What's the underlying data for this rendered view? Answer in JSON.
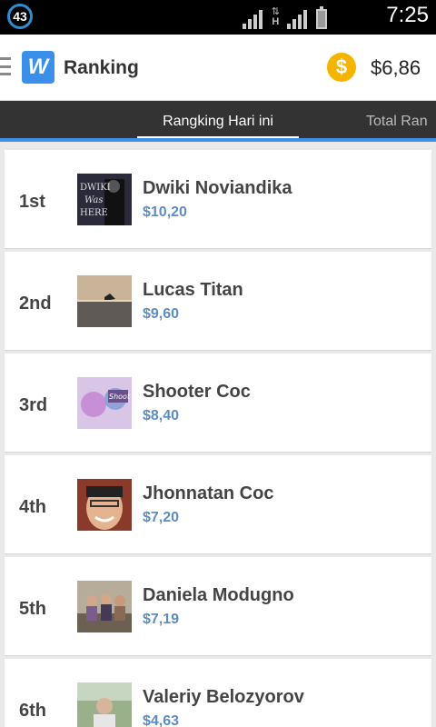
{
  "status_bar": {
    "notification_count": "43",
    "network_type": "H",
    "time": "7:25"
  },
  "app_bar": {
    "logo_letter": "W",
    "title": "Ranking",
    "coin_symbol": "$",
    "balance": "$6,86"
  },
  "tabs": [
    {
      "label": "Rangking Hari ini",
      "active": true
    },
    {
      "label": "Total Ran",
      "active": false
    }
  ],
  "ranking": [
    {
      "rank": "1st",
      "name": "Dwiki Noviandika",
      "amount": "$10,20",
      "avatar": "avatar-dark-text"
    },
    {
      "rank": "2nd",
      "name": "Lucas Titan",
      "amount": "$9,60",
      "avatar": "avatar-sea-sunset"
    },
    {
      "rank": "3rd",
      "name": "Shooter Coc",
      "amount": "$8,40",
      "avatar": "avatar-pink-graphic"
    },
    {
      "rank": "4th",
      "name": "Jhonnatan Coc",
      "amount": "$7,20",
      "avatar": "avatar-smiling-face"
    },
    {
      "rank": "5th",
      "name": "Daniela Modugno",
      "amount": "$7,19",
      "avatar": "avatar-group-photo"
    },
    {
      "rank": "6th",
      "name": "Valeriy Belozyorov",
      "amount": "$4,63",
      "avatar": "avatar-outdoor-person"
    }
  ],
  "colors": {
    "accent": "#3b8eea",
    "amount": "#5b8cc8",
    "coin": "#f5b400",
    "tabbar": "#333333"
  }
}
